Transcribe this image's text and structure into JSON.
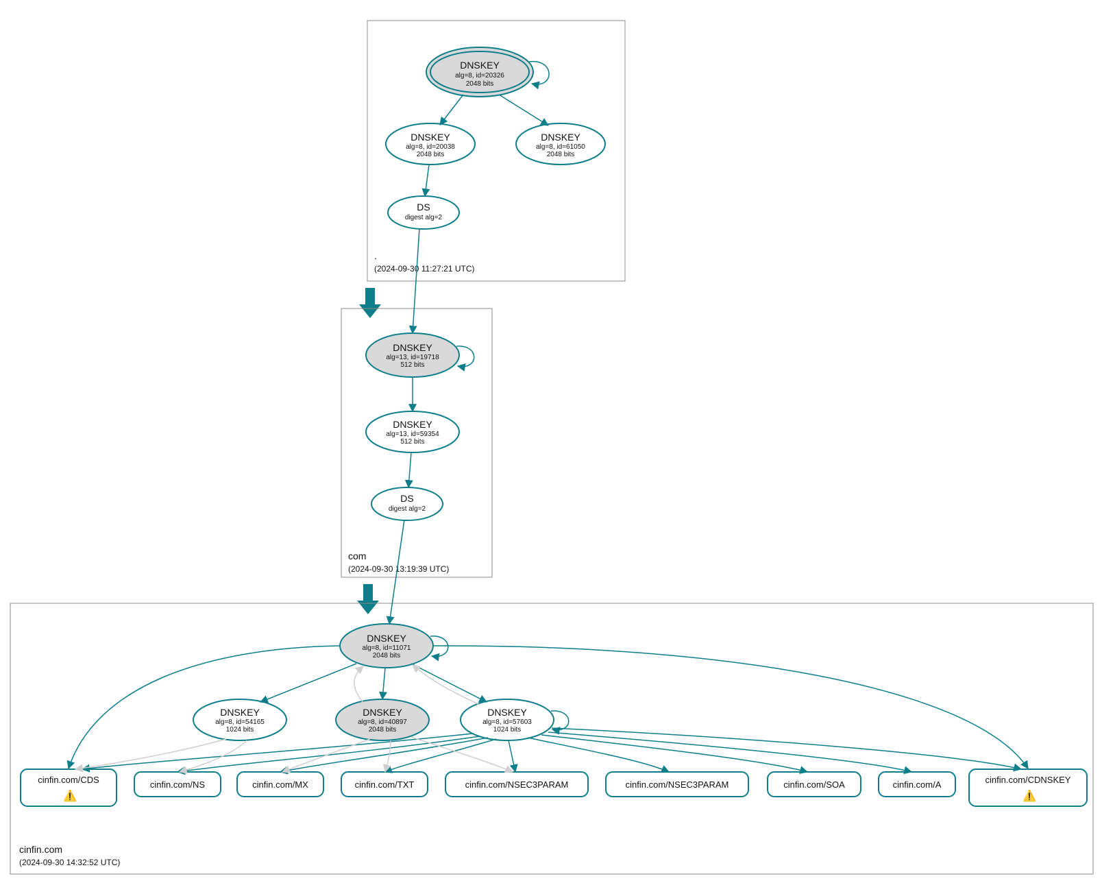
{
  "zones": {
    "root": {
      "name": ".",
      "time": "(2024-09-30 11:27:21 UTC)"
    },
    "com": {
      "name": "com",
      "time": "(2024-09-30 13:19:39 UTC)"
    },
    "leaf": {
      "name": "cinfin.com",
      "time": "(2024-09-30 14:32:52 UTC)"
    }
  },
  "nodes": {
    "root_ksk": {
      "title": "DNSKEY",
      "l1": "alg=8, id=20326",
      "l2": "2048 bits"
    },
    "root_zsk1": {
      "title": "DNSKEY",
      "l1": "alg=8, id=20038",
      "l2": "2048 bits"
    },
    "root_zsk2": {
      "title": "DNSKEY",
      "l1": "alg=8, id=61050",
      "l2": "2048 bits"
    },
    "root_ds": {
      "title": "DS",
      "l1": "digest alg=2",
      "l2": ""
    },
    "com_ksk": {
      "title": "DNSKEY",
      "l1": "alg=13, id=19718",
      "l2": "512 bits"
    },
    "com_zsk": {
      "title": "DNSKEY",
      "l1": "alg=13, id=59354",
      "l2": "512 bits"
    },
    "com_ds": {
      "title": "DS",
      "l1": "digest alg=2",
      "l2": ""
    },
    "leaf_ksk": {
      "title": "DNSKEY",
      "l1": "alg=8, id=11071",
      "l2": "2048 bits"
    },
    "leaf_k2": {
      "title": "DNSKEY",
      "l1": "alg=8, id=54165",
      "l2": "1024 bits"
    },
    "leaf_k3": {
      "title": "DNSKEY",
      "l1": "alg=8, id=40897",
      "l2": "2048 bits"
    },
    "leaf_k4": {
      "title": "DNSKEY",
      "l1": "alg=8, id=57603",
      "l2": "1024 bits"
    }
  },
  "rr": {
    "cds": "cinfin.com/CDS",
    "ns": "cinfin.com/NS",
    "mx": "cinfin.com/MX",
    "txt": "cinfin.com/TXT",
    "nsec3a": "cinfin.com/NSEC3PARAM",
    "nsec3b": "cinfin.com/NSEC3PARAM",
    "soa": "cinfin.com/SOA",
    "a": "cinfin.com/A",
    "cdnskey": "cinfin.com/CDNSKEY"
  }
}
